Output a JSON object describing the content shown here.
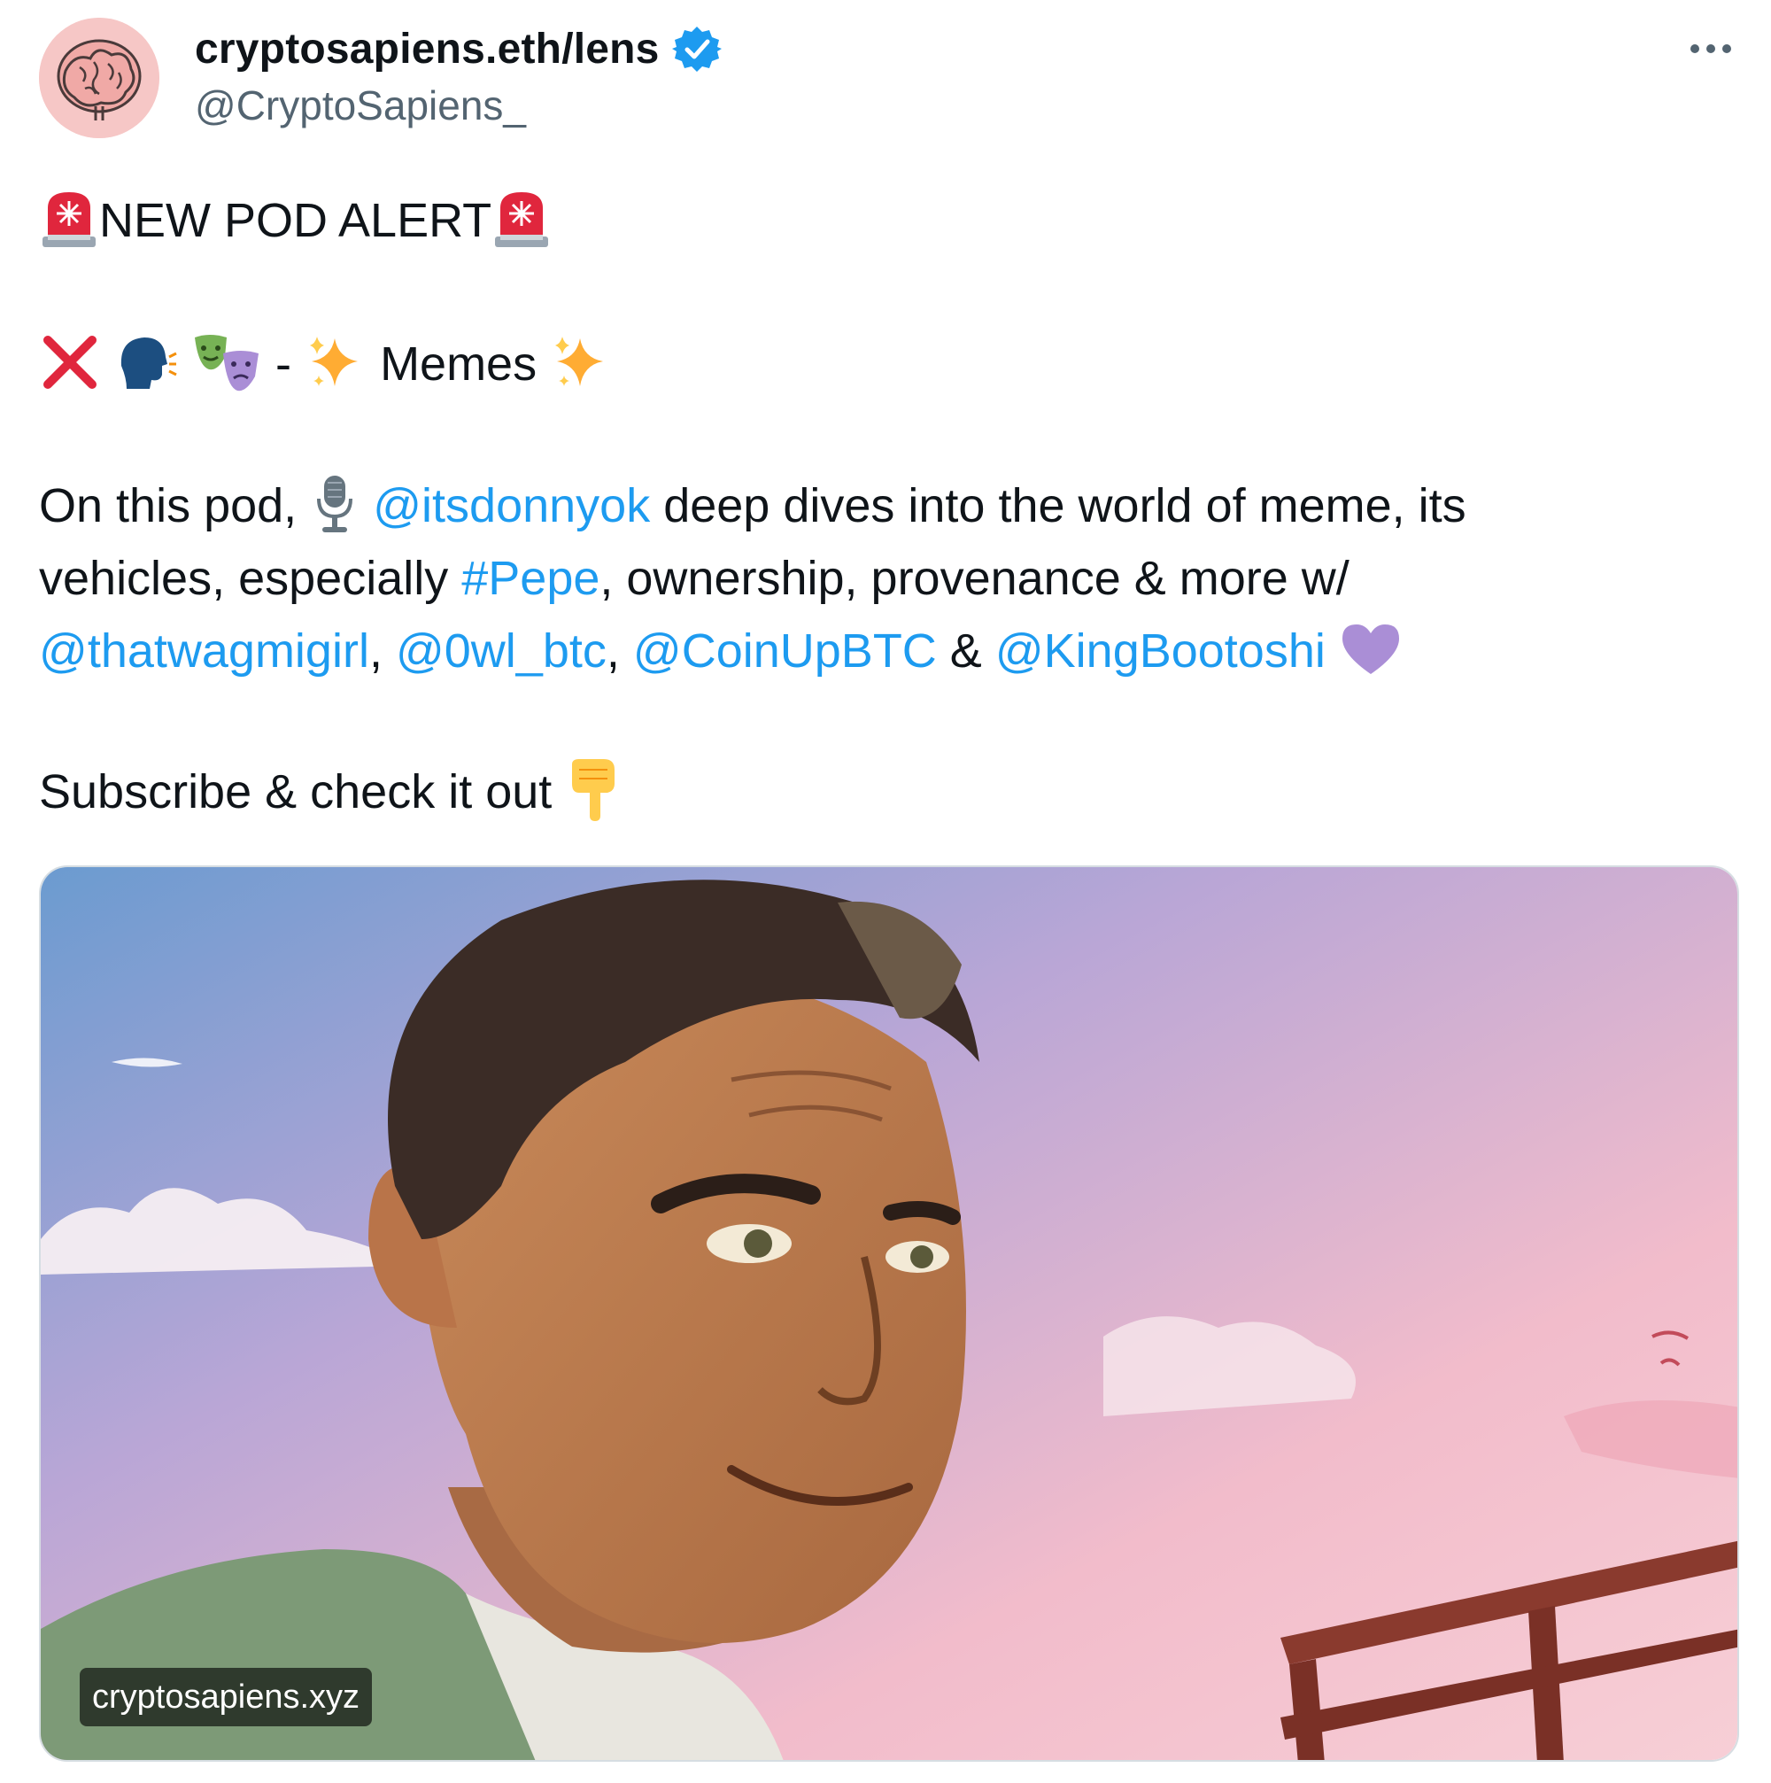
{
  "author": {
    "display_name": "cryptosapiens.eth/lens",
    "handle": "@CryptoSapiens_",
    "verified": true,
    "avatar_icon": "brain-logo-icon"
  },
  "menu": {
    "more_icon": "more-dots-icon"
  },
  "tweet": {
    "line1": {
      "text": "NEW POD ALERT",
      "leading_icon": "rotating-light-icon",
      "trailing_icon": "rotating-light-icon"
    },
    "line2": {
      "icons_before": [
        "cross-mark-icon",
        "speaking-head-icon",
        "performing-arts-icon"
      ],
      "separator": "-",
      "text": "Memes",
      "sparkle_icon": "sparkles-icon"
    },
    "para3": {
      "intro": "On this pod,",
      "mic_icon": "microphone-icon",
      "mention_host": "@itsdonnyok",
      "text1": " deep dives into the world of meme, its",
      "text2": "vehicles, especially ",
      "hashtag": "#Pepe",
      "text3": ", ownership, provenance & more w/",
      "mention_1": "@thatwagmigirl",
      "sep_1": ", ",
      "mention_2": "@0wl_btc",
      "sep_2": ", ",
      "mention_3": "@CoinUpBTC",
      "sep_3": " & ",
      "mention_4": "@KingBootoshi",
      "heart_icon": "purple-heart-icon"
    },
    "line4": {
      "text": "Subscribe & check it out",
      "pointing_icon": "backhand-index-pointing-down-icon"
    }
  },
  "media": {
    "domain_label": "cryptosapiens.xyz",
    "image_icon": "cartoon-man-portrait-image"
  },
  "colors": {
    "link": "#1d9bf0",
    "text": "#0f1419",
    "secondary": "#536471",
    "verified_badge": "#1d9bf0"
  }
}
